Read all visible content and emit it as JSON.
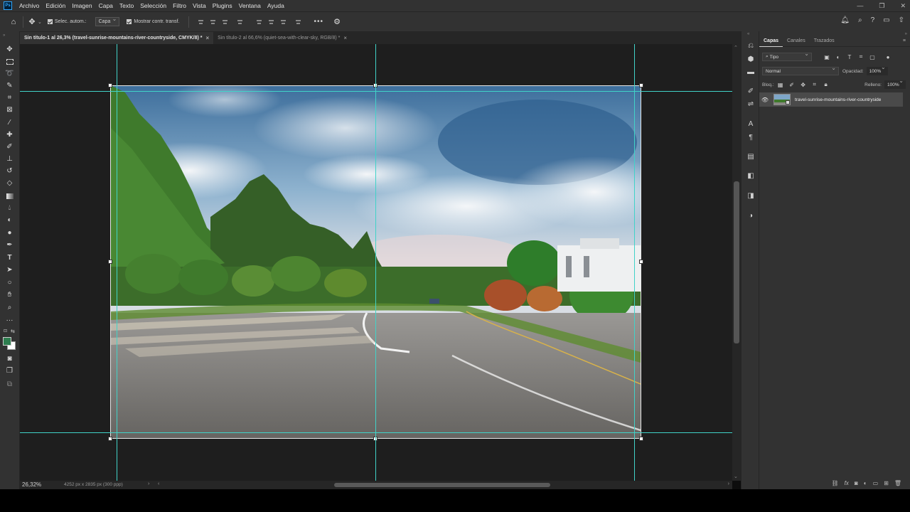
{
  "menubar": {
    "logo": "Ps",
    "items": [
      "Archivo",
      "Edición",
      "Imagen",
      "Capa",
      "Texto",
      "Selección",
      "Filtro",
      "Vista",
      "Plugins",
      "Ventana",
      "Ayuda"
    ]
  },
  "options_bar": {
    "auto_select_label": "Selec. autom.:",
    "auto_select_value": "Capa",
    "show_transform_label": "Mostrar contr. transf.",
    "more_icon": "•••"
  },
  "tabs": [
    {
      "label": "Sin título-1 al 26,3% (travel-sunrise-mountains-river-countryside, CMYK/8) *",
      "active": true
    },
    {
      "label": "Sin título-2 al 66,6% (quiet-sea-with-clear-sky, RGB/8) *",
      "active": false
    }
  ],
  "status": {
    "zoom": "26,32%",
    "doc_info": "4252 px x 2835 px (300 ppp)"
  },
  "layers_panel": {
    "tabs": [
      "Capas",
      "Canales",
      "Trazados"
    ],
    "filter_label": "Tipo",
    "blend_mode": "Normal",
    "opacity_label": "Opacidad:",
    "opacity_value": "100%",
    "lock_label": "Bloq.:",
    "fill_label": "Relleno:",
    "fill_value": "100%",
    "layers": [
      {
        "name": "travel-sunrise-mountains-river-countryside",
        "visible": true
      }
    ]
  },
  "colors": {
    "guide": "#41d3c8",
    "foreground": "#2e7d4f",
    "background": "#ffffff",
    "accent": "#31a8ff"
  }
}
